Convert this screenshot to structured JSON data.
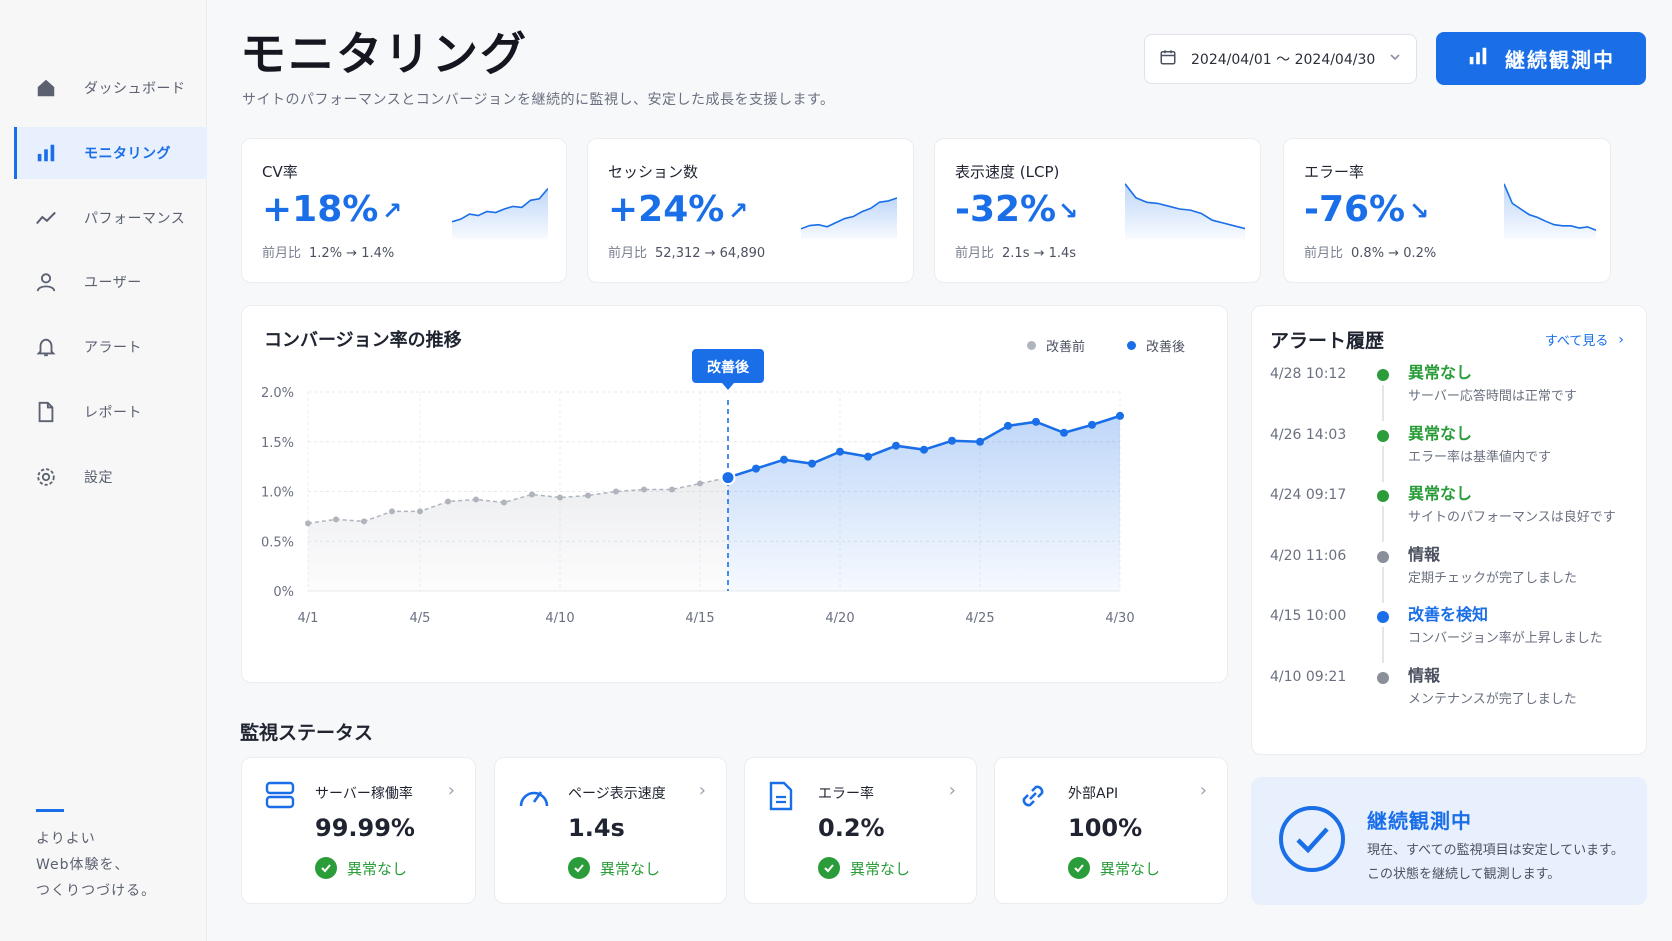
{
  "sidebar": {
    "items": [
      {
        "label": "ダッシュボード",
        "icon": "home-icon"
      },
      {
        "label": "モニタリング",
        "icon": "bar-chart-icon",
        "active": true
      },
      {
        "label": "パフォーマンス",
        "icon": "trend-icon"
      },
      {
        "label": "ユーザー",
        "icon": "user-icon"
      },
      {
        "label": "アラート",
        "icon": "bell-icon"
      },
      {
        "label": "レポート",
        "icon": "document-icon"
      },
      {
        "label": "設定",
        "icon": "gear-icon"
      }
    ],
    "tagline": [
      "よりよい",
      "Web体験を、",
      "つくりつづける。"
    ]
  },
  "header": {
    "title": "モニタリング",
    "subtitle": "サイトのパフォーマンスとコンバージョンを継続的に監視し、安定した成長を支援します。",
    "date_range": "2024/04/01 〜 2024/04/30",
    "primary_button": "継続観測中"
  },
  "kpis": [
    {
      "label": "CV率",
      "value": "+18%",
      "arrow": "↗",
      "compare_label": "前月比",
      "compare": "1.2% → 1.4%",
      "trend": [
        0.3,
        0.35,
        0.45,
        0.42,
        0.5,
        0.48,
        0.55,
        0.6,
        0.58,
        0.72,
        0.75,
        0.95
      ]
    },
    {
      "label": "セッション数",
      "value": "+24%",
      "arrow": "↗",
      "compare_label": "前月比",
      "compare": "52,312 → 64,890",
      "trend": [
        0.2,
        0.28,
        0.3,
        0.25,
        0.35,
        0.45,
        0.5,
        0.62,
        0.7,
        0.85,
        0.88,
        0.95
      ]
    },
    {
      "label": "表示速度 (LCP)",
      "value": "-32%",
      "arrow": "↘",
      "compare_label": "前月比",
      "compare": "2.1s → 1.4s",
      "trend": [
        0.95,
        0.7,
        0.62,
        0.6,
        0.55,
        0.5,
        0.48,
        0.42,
        0.3,
        0.25,
        0.2,
        0.15
      ]
    },
    {
      "label": "エラー率",
      "value": "-76%",
      "arrow": "↘",
      "compare_label": "前月比",
      "compare": "0.8% → 0.2%",
      "trend": [
        0.95,
        0.6,
        0.5,
        0.4,
        0.35,
        0.28,
        0.22,
        0.2,
        0.2,
        0.16,
        0.18,
        0.12
      ]
    }
  ],
  "chart_data": {
    "type": "line",
    "title": "コンバージョン率の推移",
    "x_ticks": [
      "4/1",
      "4/5",
      "4/10",
      "4/15",
      "4/20",
      "4/25",
      "4/30"
    ],
    "y_ticks": [
      "0%",
      "0.5%",
      "1.0%",
      "1.5%",
      "2.0%"
    ],
    "ylim": [
      0,
      2.0
    ],
    "xlim": [
      1,
      30
    ],
    "annotation": {
      "label": "改善後",
      "x": 16
    },
    "series": [
      {
        "name": "改善前",
        "color": "#b0b4bd",
        "x": [
          1,
          2,
          3,
          4,
          5,
          6,
          7,
          8,
          9,
          10,
          11,
          12,
          13,
          14,
          15,
          16
        ],
        "values": [
          0.68,
          0.72,
          0.7,
          0.8,
          0.8,
          0.9,
          0.92,
          0.89,
          0.97,
          0.94,
          0.96,
          1.0,
          1.02,
          1.02,
          1.08,
          1.14
        ]
      },
      {
        "name": "改善後",
        "color": "#1a6fe8",
        "x": [
          16,
          17,
          18,
          19,
          20,
          21,
          22,
          23,
          24,
          25,
          26,
          27,
          28,
          29,
          30
        ],
        "values": [
          1.14,
          1.23,
          1.32,
          1.28,
          1.4,
          1.35,
          1.46,
          1.42,
          1.51,
          1.5,
          1.66,
          1.7,
          1.59,
          1.67,
          1.76
        ]
      }
    ],
    "legend_position": "top-right",
    "grid": true
  },
  "status_section": {
    "title": "監視ステータス",
    "cards": [
      {
        "label": "サーバー稼働率",
        "value": "99.99%",
        "status": "異常なし",
        "icon": "server-icon"
      },
      {
        "label": "ページ表示速度",
        "value": "1.4s",
        "status": "異常なし",
        "icon": "gauge-icon"
      },
      {
        "label": "エラー率",
        "value": "0.2%",
        "status": "異常なし",
        "icon": "file-icon"
      },
      {
        "label": "外部API",
        "value": "100%",
        "status": "異常なし",
        "icon": "link-icon"
      }
    ]
  },
  "alerts": {
    "title": "アラート履歴",
    "view_all": "すべて見る",
    "items": [
      {
        "time": "4/28 10:12",
        "name": "異常なし",
        "desc": "サーバー応答時間は正常です",
        "color": "#2a9d3a"
      },
      {
        "time": "4/26 14:03",
        "name": "異常なし",
        "desc": "エラー率は基準値内です",
        "color": "#2a9d3a"
      },
      {
        "time": "4/24 09:17",
        "name": "異常なし",
        "desc": "サイトのパフォーマンスは良好です",
        "color": "#2a9d3a"
      },
      {
        "time": "4/20 11:06",
        "name": "情報",
        "desc": "定期チェックが完了しました",
        "color": "#8a8f99"
      },
      {
        "time": "4/15 10:00",
        "name": "改善を検知",
        "desc": "コンバージョン率が上昇しました",
        "color": "#1a6fe8"
      },
      {
        "time": "4/10 09:21",
        "name": "情報",
        "desc": "メンテナンスが完了しました",
        "color": "#8a8f99"
      }
    ]
  },
  "ok_banner": {
    "title": "継続観測中",
    "desc_1": "現在、すべての監視項目は安定しています。",
    "desc_2": "この状態を継続して観測します。"
  },
  "colors": {
    "accent": "#1a6fe8",
    "success": "#2a9d3a",
    "muted": "#8a8f99"
  }
}
